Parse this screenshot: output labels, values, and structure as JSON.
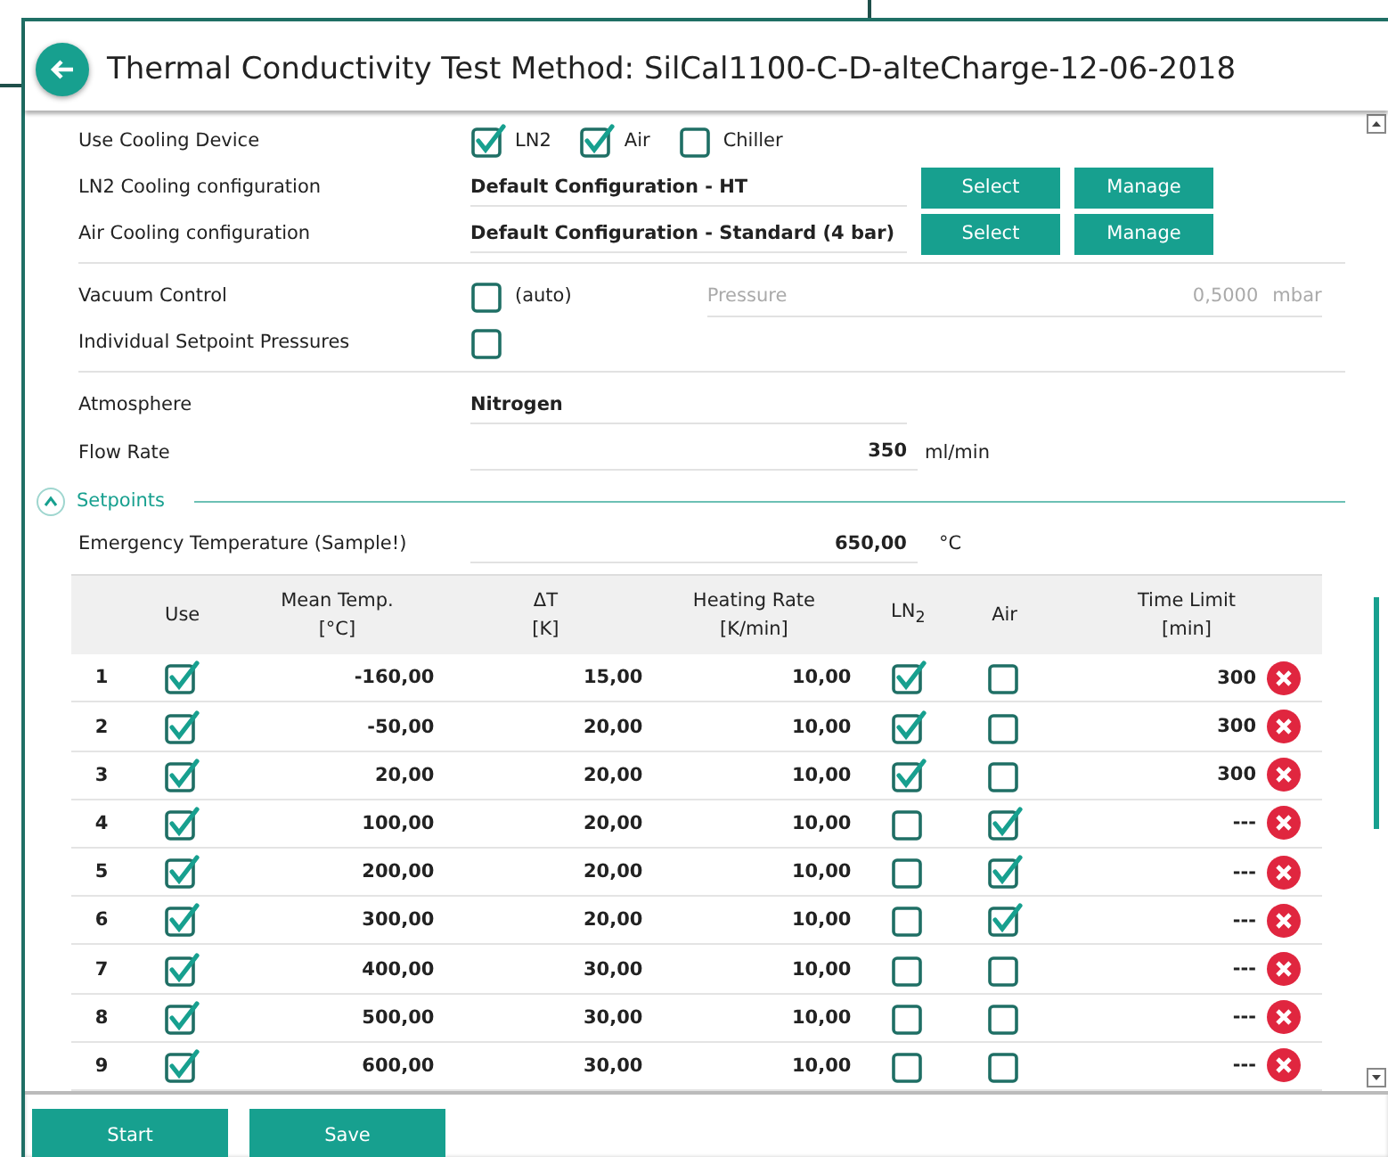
{
  "header": {
    "title": "Thermal Conductivity Test Method: SilCal1100-C-D-alteCharge-12-06-2018"
  },
  "cooling": {
    "label": "Use Cooling Device",
    "options": [
      {
        "label": "LN2",
        "checked": true
      },
      {
        "label": "Air",
        "checked": true
      },
      {
        "label": "Chiller",
        "checked": false
      }
    ]
  },
  "configurations": [
    {
      "label": "LN2 Cooling configuration",
      "value": "Default Configuration - HT",
      "buttons": [
        "Select",
        "Manage"
      ]
    },
    {
      "label": "Air Cooling configuration",
      "value": "Default Configuration - Standard (4 bar)",
      "buttons": [
        "Select",
        "Manage"
      ]
    }
  ],
  "vacuum": {
    "label": "Vacuum Control",
    "checked": false,
    "option_label": "(auto)",
    "pressure": {
      "label": "Pressure",
      "value": "0,5000",
      "unit": "mbar",
      "disabled": true
    }
  },
  "individual_setpoint_pressures": {
    "label": "Individual Setpoint Pressures",
    "checked": false
  },
  "atmosphere": {
    "label": "Atmosphere",
    "value": "Nitrogen"
  },
  "flow_rate": {
    "label": "Flow Rate",
    "value": "350",
    "unit": "ml/min"
  },
  "setpoints": {
    "title": "Setpoints",
    "expanded": true,
    "emergency": {
      "label": "Emergency Temperature (Sample!)",
      "value": "650,00",
      "unit": "°C"
    },
    "columns": [
      {
        "title": "Use"
      },
      {
        "title": "Mean Temp.",
        "unit": "[°C]"
      },
      {
        "title": "ΔT",
        "unit": "[K]"
      },
      {
        "title": "Heating Rate",
        "unit": "[K/min]"
      },
      {
        "title": "LN$_{2}$"
      },
      {
        "title": "Air"
      },
      {
        "title": "Time Limit",
        "unit": "[min]"
      }
    ],
    "rows": [
      {
        "index": "1",
        "use": true,
        "mean_temp": "-160,00",
        "delta_t": "15,00",
        "heating_rate": "10,00",
        "ln2": true,
        "air": false,
        "time_limit": "300"
      },
      {
        "index": "2",
        "use": true,
        "mean_temp": "-50,00",
        "delta_t": "20,00",
        "heating_rate": "10,00",
        "ln2": true,
        "air": false,
        "time_limit": "300"
      },
      {
        "index": "3",
        "use": true,
        "mean_temp": "20,00",
        "delta_t": "20,00",
        "heating_rate": "10,00",
        "ln2": true,
        "air": false,
        "time_limit": "300"
      },
      {
        "index": "4",
        "use": true,
        "mean_temp": "100,00",
        "delta_t": "20,00",
        "heating_rate": "10,00",
        "ln2": false,
        "air": true,
        "time_limit": "---"
      },
      {
        "index": "5",
        "use": true,
        "mean_temp": "200,00",
        "delta_t": "20,00",
        "heating_rate": "10,00",
        "ln2": false,
        "air": true,
        "time_limit": "---"
      },
      {
        "index": "6",
        "use": true,
        "mean_temp": "300,00",
        "delta_t": "20,00",
        "heating_rate": "10,00",
        "ln2": false,
        "air": true,
        "time_limit": "---"
      },
      {
        "index": "7",
        "use": true,
        "mean_temp": "400,00",
        "delta_t": "30,00",
        "heating_rate": "10,00",
        "ln2": false,
        "air": false,
        "time_limit": "---"
      },
      {
        "index": "8",
        "use": true,
        "mean_temp": "500,00",
        "delta_t": "30,00",
        "heating_rate": "10,00",
        "ln2": false,
        "air": false,
        "time_limit": "---"
      },
      {
        "index": "9",
        "use": true,
        "mean_temp": "600,00",
        "delta_t": "30,00",
        "heating_rate": "10,00",
        "ln2": false,
        "air": false,
        "time_limit": "---"
      }
    ]
  },
  "buttons": [
    "Start",
    "Save"
  ]
}
